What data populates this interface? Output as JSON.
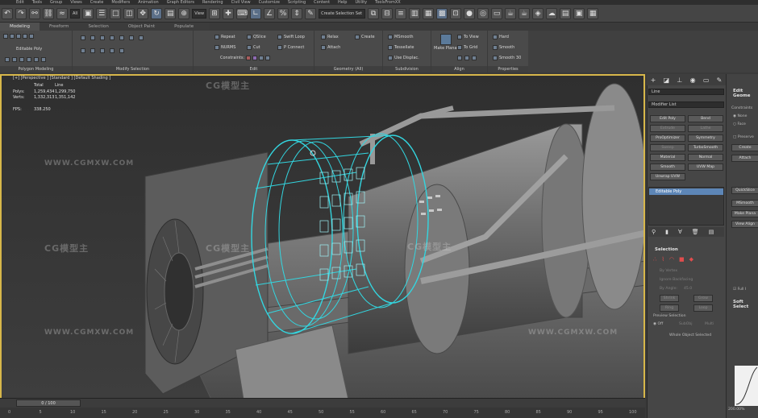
{
  "menubar": [
    "Edit",
    "Tools",
    "Group",
    "Views",
    "Create",
    "Modifiers",
    "Animation",
    "Graph Editors",
    "Rendering",
    "Civil View",
    "Customize",
    "Scripting",
    "Content",
    "Help",
    "Utility",
    "ToolsFromXX"
  ],
  "toolbar": {
    "selection_filter": "All",
    "view_dropdown": "View",
    "selection_set": "Create Selection Set"
  },
  "ribbon_tabs": [
    "Modeling",
    "Freeform",
    "Selection",
    "Object Paint",
    "Populate"
  ],
  "ribbon": {
    "editable_poly": "Editable Poly",
    "polygon_modeling": "Polygon Modeling",
    "modify_selection": "Modify Selection",
    "edit_group": "Edit",
    "geometry_group": "Geometry (All)",
    "subdivision_group": "Subdivision",
    "align_group": "Align",
    "properties_group": "Properties",
    "repeat": "Repeat",
    "qslice": "QSlice",
    "swift_loop": "Swift Loop",
    "nurms": "NURMS",
    "cut": "Cut",
    "p_connect": "P Connect",
    "constraints": "Constraints:",
    "relax": "Relax",
    "create": "Create",
    "attach": "Attach",
    "msmooth": "MSmooth",
    "tessellate": "Tessellate",
    "use_displac": "Use Displac.",
    "make_planar": "Make Planar",
    "to_view": "To View",
    "to_grid": "To Grid",
    "hard": "Hard",
    "smooth": "Smooth",
    "smooth30": "Smooth 30"
  },
  "viewport": {
    "label": "[+] [Perspective ] [Standard ] [Default Shading ]",
    "stats_header": [
      "",
      "Total",
      "Line"
    ],
    "polys_label": "Polys:",
    "polys_total": "1,259,434",
    "polys_line": "1,299,750",
    "verts_label": "Verts:",
    "verts_total": "1,332,313",
    "verts_line": "1,351,142",
    "fps_label": "FPS:",
    "fps_value": "338.250",
    "watermarks": [
      "CG模型主",
      "WWW.CGMXW.COM"
    ]
  },
  "timeline": {
    "slider": "0 / 100",
    "ticks": [
      "0",
      "5",
      "10",
      "15",
      "20",
      "25",
      "30",
      "35",
      "40",
      "45",
      "50",
      "55",
      "60",
      "65",
      "70",
      "75",
      "80",
      "85",
      "90",
      "95",
      "100"
    ]
  },
  "command_panel": {
    "object_name": "Line",
    "modifier_list": "Modifier List",
    "buttons": [
      {
        "label": "Edit Poly",
        "dim": false
      },
      {
        "label": "Bend",
        "dim": false
      },
      {
        "label": "Extrude",
        "dim": true
      },
      {
        "label": "Lathe",
        "dim": true
      },
      {
        "label": "ProOptimizer",
        "dim": false
      },
      {
        "label": "Symmetry",
        "dim": false
      },
      {
        "label": "Sweep",
        "dim": true
      },
      {
        "label": "TurboSmooth",
        "dim": false
      },
      {
        "label": "Material",
        "dim": false
      },
      {
        "label": "Normal",
        "dim": false
      },
      {
        "label": "Smooth",
        "dim": false
      },
      {
        "label": "UVW Map",
        "dim": false
      },
      {
        "label": "Unwrap UVW",
        "dim": false
      }
    ],
    "stack_item": "Editable Poly",
    "selection_title": "Selection",
    "by_vertex": "By Vertex",
    "ignore_backfacing": "Ignore Backfacing",
    "by_angle": "By Angle:",
    "by_angle_value": "45.0",
    "shrink": "Shrink",
    "grow": "Grow",
    "ring": "Ring",
    "loop": "Loop",
    "preview_selection": "Preview Selection",
    "off": "Off",
    "subobj": "SubObj",
    "multi": "Multi",
    "whole_object_selected": "Whole Object Selected"
  },
  "command_panel2": {
    "edit_geometry": "Edit Geome",
    "constraints": "Constraints",
    "none": "None",
    "face": "Face",
    "preserve": "Preserve",
    "create": "Create",
    "attach": "Attach",
    "quickslice": "QuickSlice",
    "msmooth": "MSmooth",
    "make_planar": "Make Plana",
    "view_align": "View Align",
    "soft_selection": "Soft Select",
    "full": "Full I",
    "percent": "200.00%"
  },
  "colors": {
    "accent": "#d7b74a",
    "selection_wire": "#33d6e0",
    "stack_highlight": "#5d86b7"
  }
}
